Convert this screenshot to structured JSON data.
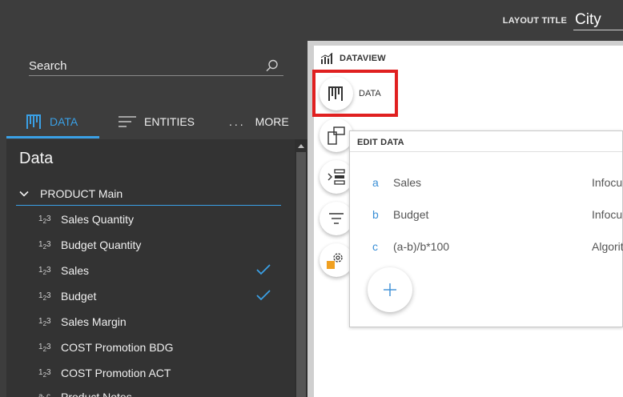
{
  "header": {
    "layout_title_label": "LAYOUT TITLE",
    "layout_title_value": "City"
  },
  "left_panel": {
    "search_placeholder": "Search",
    "tabs": [
      {
        "label": "DATA",
        "icon": "data-grid-icon",
        "active": true
      },
      {
        "label": "ENTITIES",
        "icon": "list-lines-icon",
        "active": false
      },
      {
        "label": "MORE",
        "icon": "ellipsis-icon",
        "active": false
      }
    ],
    "heading": "Data",
    "group_label": "PRODUCT Main",
    "fields": [
      {
        "type": "123",
        "label": "Sales Quantity",
        "checked": false
      },
      {
        "type": "123",
        "label": "Budget Quantity",
        "checked": false
      },
      {
        "type": "123",
        "label": "Sales",
        "checked": true
      },
      {
        "type": "123",
        "label": "Budget",
        "checked": true
      },
      {
        "type": "123",
        "label": "Sales Margin",
        "checked": false
      },
      {
        "type": "123",
        "label": "COST Promotion BDG",
        "checked": false
      },
      {
        "type": "123",
        "label": "COST Promotion ACT",
        "checked": false
      },
      {
        "type": "abc",
        "label": "Product Notes",
        "checked": false
      }
    ]
  },
  "dataview": {
    "title": "DATAVIEW",
    "data_button_label": "DATA",
    "side_buttons": [
      "data-grid-icon",
      "layout-panels-icon",
      "expand-tree-icon",
      "filter-icon",
      "settings-gear-icon"
    ]
  },
  "edit_data": {
    "title": "EDIT DATA",
    "rows": [
      {
        "letter": "a",
        "name": "Sales",
        "source": "Infocube"
      },
      {
        "letter": "b",
        "name": "Budget",
        "source": "Infocube"
      },
      {
        "letter": "c",
        "name": "(a-b)/b*100",
        "source": "Algorithm"
      }
    ],
    "add_icon": "plus-icon"
  },
  "colors": {
    "accent": "#3aa0e6",
    "highlight_frame": "#e02020",
    "dark_bg": "#3d3d3d",
    "status_orange": "#f0a020"
  }
}
